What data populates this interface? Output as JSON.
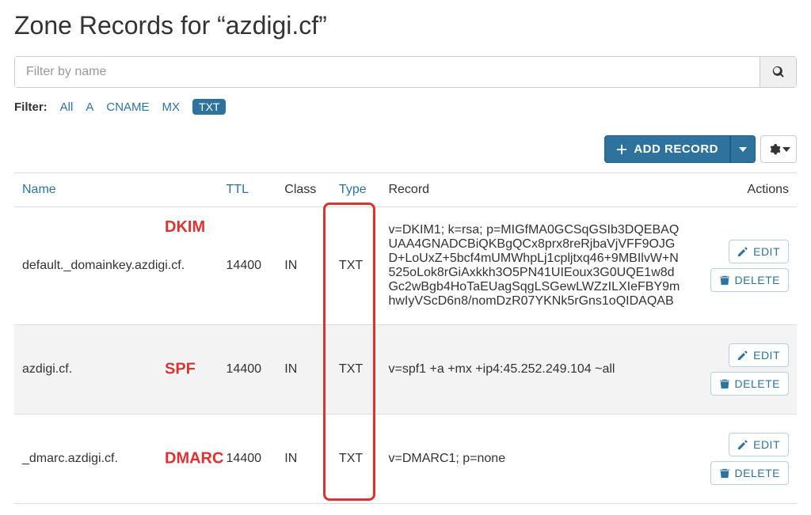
{
  "page_title": "Zone Records for “azdigi.cf”",
  "search": {
    "placeholder": "Filter by name"
  },
  "filter": {
    "label": "Filter:",
    "items": [
      "All",
      "A",
      "CNAME",
      "MX",
      "TXT"
    ],
    "active": "TXT"
  },
  "buttons": {
    "add_record": "ADD RECORD",
    "edit": "EDIT",
    "delete": "DELETE"
  },
  "table": {
    "headers": {
      "name": "Name",
      "ttl": "TTL",
      "class": "Class",
      "type": "Type",
      "record": "Record",
      "actions": "Actions"
    },
    "rows": [
      {
        "name": "default._domainkey.azdigi.cf.",
        "ttl": "14400",
        "class": "IN",
        "type": "TXT",
        "record": "v=DKIM1; k=rsa; p=MIGfMA0GCSqGSIb3DQEBAQUAA4GNADCBiQKBgQCx8prx8reRjbaVjVFF9OJGD+LoUxZ+5bcf4mUMWhpLj1cpljtxq46+9MBIlvW+N525oLok8rGiAxkkh3O5PN41UIEoux3G0UQE1w8dGc2wBgb4HoTaEUagSqgLSGewLWZzILXIeFBY9mhwIyVScD6n8/nomDzR07YKNk5rGns1oQIDAQAB"
      },
      {
        "name": "azdigi.cf.",
        "ttl": "14400",
        "class": "IN",
        "type": "TXT",
        "record": "v=spf1 +a +mx +ip4:45.252.249.104 ~all"
      },
      {
        "name": "_dmarc.azdigi.cf.",
        "ttl": "14400",
        "class": "IN",
        "type": "TXT",
        "record": "v=DMARC1; p=none"
      }
    ]
  },
  "annotations": {
    "dkim": "DKIM",
    "spf": "SPF",
    "dmarc": "DMARC"
  }
}
